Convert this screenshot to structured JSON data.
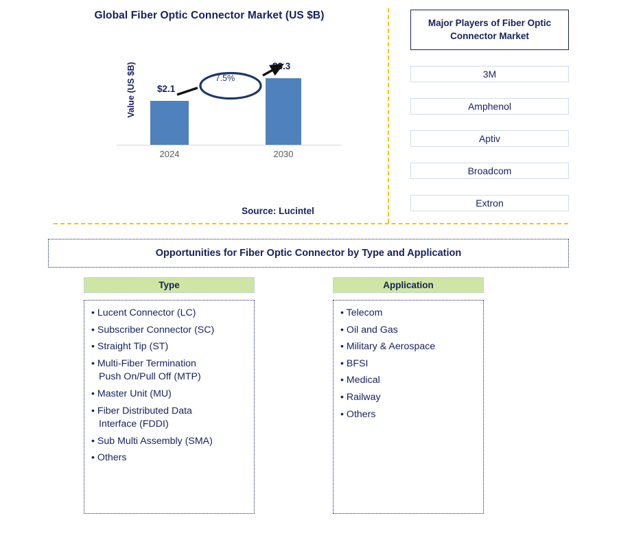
{
  "chart": {
    "title": "Global Fiber Optic Connector Market (US $B)",
    "y_axis_label": "Value (US $B)",
    "source_note": "Source: Lucintel",
    "bar_color": "#4f81bd",
    "text_color": "#16205c"
  },
  "chart_data": {
    "type": "bar",
    "title": "Global Fiber Optic Connector Market (US $B)",
    "categories": [
      "2024",
      "2030"
    ],
    "values": [
      2.1,
      3.3
    ],
    "data_labels": [
      "$2.1",
      "$3.3"
    ],
    "xlabel": "",
    "ylabel": "Value (US $B)",
    "ylim": [
      0,
      3.6
    ],
    "grid": false,
    "legend": "none",
    "annotations": [
      {
        "label": "7.5%",
        "type": "cagr-callout-ellipse",
        "from": "2024",
        "to": "2030"
      }
    ],
    "source": "Source: Lucintel"
  },
  "players": {
    "header": "Major Players of Fiber Optic Connector Market",
    "items": [
      {
        "label": "3M"
      },
      {
        "label": "Amphenol"
      },
      {
        "label": "Aptiv"
      },
      {
        "label": "Broadcom"
      },
      {
        "label": "Extron"
      }
    ]
  },
  "opportunities": {
    "banner": "Opportunities for Fiber Optic Connector by Type and Application",
    "type": {
      "header": "Type",
      "items": [
        "Lucent Connector (LC)",
        "Subscriber Connector (SC)",
        "Straight Tip (ST)",
        "Multi-Fiber Termination\nPush On/Pull Off (MTP)",
        "Master Unit (MU)",
        "Fiber Distributed Data\nInterface (FDDI)",
        "Sub Multi Assembly (SMA)",
        "Others"
      ]
    },
    "application": {
      "header": "Application",
      "items": [
        "Telecom",
        "Oil and Gas",
        "Military & Aerospace",
        "BFSI",
        "Medical",
        "Railway",
        "Others"
      ]
    }
  },
  "colors": {
    "accent_gold": "#ffc000",
    "navy": "#16205c",
    "bar_blue": "#4f81bd",
    "header_green": "#cfe5a3"
  }
}
